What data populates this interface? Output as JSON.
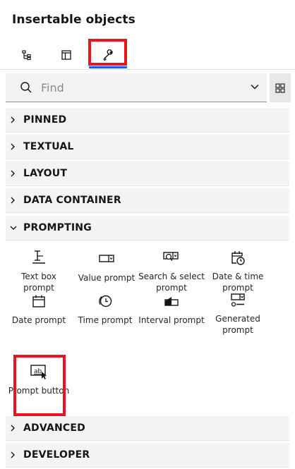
{
  "panel": {
    "title": "Insertable objects"
  },
  "tabs": [
    {
      "icon": "tree-structure-icon",
      "active": false
    },
    {
      "icon": "layout-template-icon",
      "active": false
    },
    {
      "icon": "wrench-tools-icon",
      "active": true
    }
  ],
  "search": {
    "placeholder": "Find",
    "value": ""
  },
  "sections": {
    "pinned": "PINNED",
    "textual": "TEXTUAL",
    "layout": "LAYOUT",
    "data_container": "DATA CONTAINER",
    "prompting": "PROMPTING",
    "advanced": "ADVANCED",
    "developer": "DEVELOPER"
  },
  "prompting_items": {
    "text_box": "Text box prompt",
    "value": "Value prompt",
    "search_select": "Search & select prompt",
    "date_time": "Date & time prompt",
    "date": "Date prompt",
    "time": "Time prompt",
    "interval": "Interval prompt",
    "generated": "Generated prompt",
    "button": "Prompt button"
  },
  "colors": {
    "accent": "#0f62fe",
    "highlight": "#e8141e",
    "section_bg": "#f4f4f4"
  }
}
